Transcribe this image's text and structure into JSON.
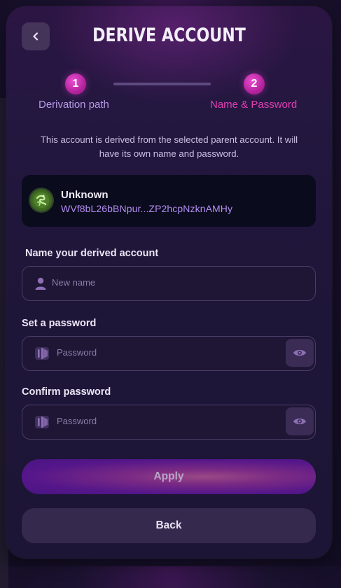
{
  "header": {
    "title": "DERIVE ACCOUNT",
    "back_icon": "chevron-left-icon"
  },
  "steps": [
    {
      "number": "1",
      "label": "Derivation path"
    },
    {
      "number": "2",
      "label": "Name & Password"
    }
  ],
  "description": "This account is derived from the selected parent account. It will have its own name and password.",
  "parent_account": {
    "name": "Unknown",
    "address": "WVf8bL26bBNpur...ZP2hcpNzknAMHy"
  },
  "form": {
    "name_label": "Name your derived account",
    "name_placeholder": "New name",
    "password_label": "Set a password",
    "password_placeholder": "Password",
    "confirm_label": "Confirm password",
    "confirm_placeholder": "Password"
  },
  "buttons": {
    "apply": "Apply",
    "back": "Back"
  },
  "colors": {
    "accent_pink": "#e33fb5",
    "step_label_active": "#b79be8",
    "address": "#b38df0"
  }
}
